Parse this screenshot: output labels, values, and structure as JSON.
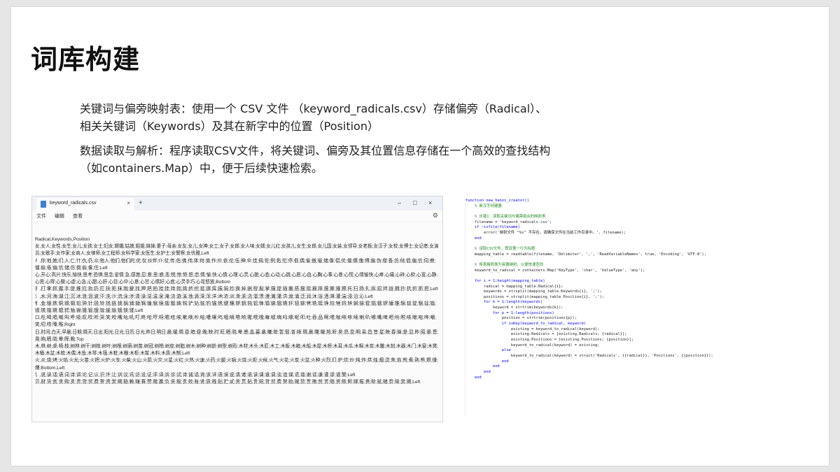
{
  "slide": {
    "title": "词库构建",
    "paragraph1": "关键词与偏旁映射表：使用一个 CSV 文件 （keyword_radicals.csv）存储偏旁（Radical）、相关关键词（Keywords）及其在新字中的位置（Position）",
    "paragraph2": "数据读取与解析：程序读取CSV文件，将关键词、偏旁及其位置信息存储在一个高效的查找结构（如containers.Map）中，便于后续快速检索。"
  },
  "notepad": {
    "tab_label": "keyword_radicals.csv",
    "close_glyph": "×",
    "add_glyph": "+",
    "window_controls": [
      "–",
      "□",
      "×"
    ],
    "menu": [
      "文件",
      "编辑",
      "查看"
    ],
    "lines": [
      "Radical,Keywords,Position",
      "女,女人;女性;女生;女儿;女孩;女士;妇女;嫦娥;姑娘;姐姐;妹妹;妻子;母亲;女友;女儿;女神;女工;女子;女郎;女人味;女婿;女儿红;女孩儿;女生;女郎;女儿国;女装;女领导;女老板;女汉子;女校;女博士;女记者;女演员;女歌手;女作家;女商人;女律师;女工程师;女科学家;女医生;女护士;女警察;女优雅,Left",
      "亻,你;他;她;们;人;仁;什;仇;仍;众;他人;他们;他们的;优;仅;伙伴;仆;仗;传;伯;佛;伟;体;何;值;作;价;依;伦;伍;伸;伞;佳;佩;佐;例;佑;佗;停;假;偶;偷;傲;催;储;像;偿;优;僵;儒;傀;傅;偏;伪;僧;备;仿;倾;倡;偏;信;伺;僚;僵;偷;倦;偏;信;储;仿;倒;偷;像;住;Left",
      "心,开心;高兴;快乐;愉快;思考;恐惧;思念;爱情;急;感激;忍;意;思;惑;悲;悦;惊;愤;怒;恋;情;愉;快;心情;心理;心灵;心脏;心态;心动;心跳;心愿;心血;心胸;心事;心意;心慌;心情愉快;心疼;心痛;心碎;心软;心宽;心静;心思;心得;心酸;心虚;心急;心甜;心肝;心目;心中;心意;心甘;心情好;心底;心灵手巧;心花怒放,Bottom",
      "扌,打;拿;抓;握;手;提;推;拉;抬;扔;扛;扶;拒;抹;抱;披;找;押;把;拍;拾;挂;持;指;挑;挤;挖;挺;挪;挥;振;捐;捡;换;掉;据;授;掘;掌;描;提;插;搬;搭;摆;摇;摘;摔;摸;撕;撞;擦;托;扫;扬;扎;拆;招;拌;拢;拥;抄;抗;折;抓;担;Left",
      "氵,水;河;海;湖;江;沉;冰;浪;泪;波;汗;洗;沙;流;泳;涉;清;澡;湿;温;泉;淹;浇;游;溪;渔;滴;深;浑;洋;洲;浓;淡;滑;滚;浇;溜;漂;漫;潮;灌;洪;渡;涌;泛;润;沐;浴;洒;淋;灌;湍;浸;沿;沁;Left",
      "钅,金;银;铁;铜;锡;钢;铅;钟;针;锐;铃;钱;链;锁;锅;铺;锄;锦;锤;锯;镜;锻;镀;铸;钩;铲;钻;铭;钓;锚;锈;键;镶;锣;钥;钝;铝;锋;镇;镐;锢;锵;钎;钮;铆;铐;铣;铤;铮;铰;锉;锊;锌;锏;锑;锟;锠;锢;锣;锤;锥;锦;锬;锭;锯;锰;锱;锲;锳;锴;锵;锶;锷;锸;锹;锺;锻;锼;锽;锾;锿;镀;镁;镂;Left",
      "口,吃;喝;唱;喊;叫;呼;吸;叹;吹;听;哭;笑;咬;嘴;咕;叽;叮;咚;哈;哼;呀;嗯;哇;咳;嗽;唤;吵;喧;嘈;嚷;呜;咽;嘀;嗒;哟;喔;喂;哦;嘛;嘘;嗨;吗;哪;呢;叩;吐;吞;品;啊;喂;咖;啡;哆;嗦;喇;叭;嘟;嘴;啤;吧;吩;咐;咳;嗽;喧;哗;嘲;笑;叨;唠;嗓;喉;Right",
      "日,时间;白天;早晨;日期;晴天;日出;阳光;日光;日历;日光;昨日;明日;晨;暖;晴;昏;暗;昼;晚;映;时;旺;晒;晓;晕;景;晶;暮;暴;曦;晾;暂;智;普;晰;晴;晨;曙;曜;旭;昕;昊;昂;昆;明;易;昌;昔;星;映;春;昧;是;显;昨;昭;晏;晋;晃;晌;晒;晓;晕;晖;晚;Top",
      "木,林;树;桌;椅;枝;树林;树干;树枝;树叶;树根;树荫;树苗;树冠;树梢;树皮;树脂;树木;树种;树龄;树型;树形;木材;木头;木匠;木工;木板;木箱;木船;木屋;木桥;木耳;木瓜;木棉;木炭;木雕;木刻;木器;木门;木窗;木凳;木桶;木盆;木梳;木偶;木鱼;木琴;木筏;木桩;木栅;木柜;木架;木料;木质;木制;Left",
      "火,炎;烧;烤;火焰;火光;火苗;火把;火炉;火车;火柴;火山;火箭;火灾;火星;火红;火热;火速;火药;火腿;火锅;火烧;火炬;火候;火气;火花;火炭;火盆;火种;火烈;灯;炉;炊;炒;炖;炸;烘;烛;烟;烫;焦;焰;煎;煮;熟;熊;燃;燥;爆;Bottom,Left",
      "讠,说;读;话;语;词;诗;讲;论;记;认;识;许;让;训;议;讯;访;设;证;评;译;诉;诊;试;诗;诚;话;询;该;详;语;误;说;请;诸;诺;读;课;谁;调;谈;谊;谋;谎;谐;谢;谣;谦;谨;谬;谱;警;Left",
      "贝,财;货;贫;贪;购;贯;贵;贷;贸;费;贺;资;赏;赐;赔;赖;赚;赛;赞;赠;赢;负;贡;贩;责;败;账;贤;质;贱;贴;贮;贰;贲;贳;贴;贵;贶;贷;贸;费;贺;贻;贼;贽;贾;贿;赀;赁;赂;资;赅;赆;赇;赈;赉;赊;赋;赌;赍;赎;赏;赐;Left"
    ]
  },
  "code": {
    "lines": [
      {
        "t": "function new_hanzi_creator()",
        "cls": "k"
      },
      {
        "t": "    % 新汉字创建器",
        "cls": "c"
      },
      {
        "t": "",
        "cls": "t"
      },
      {
        "t": "    % 步骤1：读取关键词与偏旁组合的映射表",
        "cls": "c"
      },
      {
        "t": "    filename = 'keyword_radicals.csv';",
        "cls": "t"
      },
      {
        "t": "    if ~isfile(filename)",
        "cls": "k"
      },
      {
        "t": "        error('映射文件 \"%s\" 不存在，请确保文件在当前工作目录中。', filename);",
        "cls": "t"
      },
      {
        "t": "    end",
        "cls": "k"
      },
      {
        "t": "",
        "cls": "t"
      },
      {
        "t": "    % 读取CSV文件，假设第一行为标题",
        "cls": "c"
      },
      {
        "t": "    mapping_table = readtable(filename, 'Delimiter', ',', 'ReadVariableNames', true, 'Encoding', 'UTF-8');",
        "cls": "t"
      },
      {
        "t": "",
        "cls": "t"
      },
      {
        "t": "    % 将表格转换为容器映射，以便快速查找",
        "cls": "c"
      },
      {
        "t": "    keyword_to_radical = containers.Map('KeyType', 'char', 'ValueType', 'any');",
        "cls": "t"
      },
      {
        "t": "",
        "cls": "t"
      },
      {
        "t": "    for i = 1:height(mapping_table)",
        "cls": "k"
      },
      {
        "t": "        radical = mapping_table.Radical{i};",
        "cls": "t"
      },
      {
        "t": "        keywords = strsplit(mapping_table.Keywords{i}, ';');",
        "cls": "t"
      },
      {
        "t": "        positions = strsplit(mapping_table.Position{i}, ';');",
        "cls": "t"
      },
      {
        "t": "        for k = 1:length(keywords)",
        "cls": "k"
      },
      {
        "t": "            keyword = strtrim(keywords{k});",
        "cls": "t"
      },
      {
        "t": "            for p = 1:length(positions)",
        "cls": "k"
      },
      {
        "t": "                position = strtrim(positions{p});",
        "cls": "t"
      },
      {
        "t": "                if isKey(keyword_to_radical, keyword)",
        "cls": "k"
      },
      {
        "t": "                    existing = keyword_to_radical(keyword);",
        "cls": "t"
      },
      {
        "t": "                    existing.Radicals = [existing.Radicals; {radical}];",
        "cls": "t"
      },
      {
        "t": "                    existing.Positions = [existing.Positions; {position}];",
        "cls": "t"
      },
      {
        "t": "                    keyword_to_radical(keyword) = existing;",
        "cls": "t"
      },
      {
        "t": "                else",
        "cls": "k"
      },
      {
        "t": "                    keyword_to_radical(keyword) = struct('Radicals', {{radical}}, 'Positions', {{position}});",
        "cls": "t"
      },
      {
        "t": "                end",
        "cls": "k"
      },
      {
        "t": "            end",
        "cls": "k"
      },
      {
        "t": "        end",
        "cls": "k"
      },
      {
        "t": "    end",
        "cls": "k"
      }
    ]
  }
}
